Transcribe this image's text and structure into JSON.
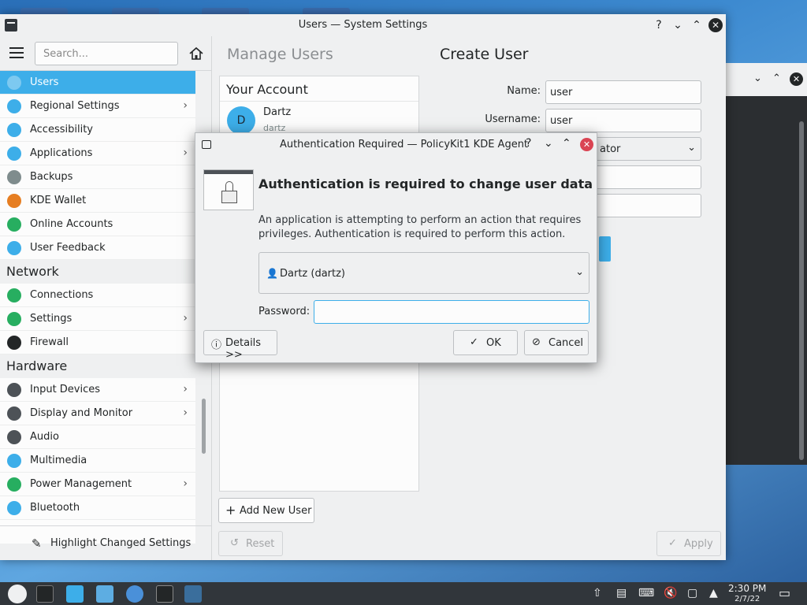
{
  "window": {
    "title": "Users — System Settings",
    "buttons": {
      "help": "?",
      "minimize": "⌄",
      "maximize": "⌃",
      "close": "✕"
    }
  },
  "sidebar": {
    "search_placeholder": "Search...",
    "items": [
      {
        "label": "Users",
        "icon": "users-icon",
        "selected": true,
        "chevron": false,
        "color": "#3daee9"
      },
      {
        "label": "Regional Settings",
        "icon": "flag-icon",
        "chevron": true,
        "color": "#3daee9"
      },
      {
        "label": "Accessibility",
        "icon": "accessibility-icon",
        "chevron": false,
        "color": "#3daee9"
      },
      {
        "label": "Applications",
        "icon": "applications-icon",
        "chevron": true,
        "color": "#3daee9"
      },
      {
        "label": "Backups",
        "icon": "backup-icon",
        "chevron": false,
        "color": "#7f8c8d"
      },
      {
        "label": "KDE Wallet",
        "icon": "wallet-icon",
        "chevron": false,
        "color": "#e67e22"
      },
      {
        "label": "Online Accounts",
        "icon": "globe-icon",
        "chevron": false,
        "color": "#27ae60"
      },
      {
        "label": "User Feedback",
        "icon": "feedback-icon",
        "chevron": false,
        "color": "#3daee9"
      }
    ],
    "network_header": "Network",
    "network_items": [
      {
        "label": "Connections",
        "icon": "network-globe-icon",
        "chevron": false,
        "color": "#27ae60"
      },
      {
        "label": "Settings",
        "icon": "network-settings-icon",
        "chevron": true,
        "color": "#27ae60"
      },
      {
        "label": "Firewall",
        "icon": "shield-icon",
        "chevron": false,
        "color": "#232627"
      }
    ],
    "hardware_header": "Hardware",
    "hardware_items": [
      {
        "label": "Input Devices",
        "icon": "keyboard-icon",
        "chevron": true,
        "color": "#4d5257"
      },
      {
        "label": "Display and Monitor",
        "icon": "monitor-icon",
        "chevron": true,
        "color": "#4d5257"
      },
      {
        "label": "Audio",
        "icon": "speaker-icon",
        "chevron": false,
        "color": "#4d5257"
      },
      {
        "label": "Multimedia",
        "icon": "multimedia-icon",
        "chevron": false,
        "color": "#3daee9"
      },
      {
        "label": "Power Management",
        "icon": "power-icon",
        "chevron": true,
        "color": "#27ae60"
      },
      {
        "label": "Bluetooth",
        "icon": "bluetooth-icon",
        "chevron": false,
        "color": "#3daee9"
      }
    ],
    "highlight_label": "Highlight Changed Settings"
  },
  "main": {
    "crumb_manage": "Manage Users",
    "crumb_create": "Create User",
    "account_header": "Your Account",
    "account_name": "Dartz",
    "account_username": "dartz",
    "avatar_letter": "D",
    "add_user_label": "Add New User",
    "reset_label": "Reset",
    "apply_label": "Apply",
    "form": {
      "name_label": "Name:",
      "name_value": "user",
      "username_label": "Username:",
      "username_value": "user",
      "type_value_partial": "ator"
    }
  },
  "dialog": {
    "title": "Authentication Required — PolicyKit1 KDE Agent",
    "heading": "Authentication is required to change user data",
    "message": "An application is attempting to perform an action that requires privileges. Authentication is required to perform this action.",
    "user_selected": "Dartz (dartz)",
    "password_label": "Password:",
    "password_value": "",
    "details_label": "Details >>",
    "ok_label": "OK",
    "cancel_label": "Cancel"
  },
  "taskbar": {
    "time": "2:30 PM",
    "date": "2/7/22"
  },
  "colors": {
    "accent": "#3daee9",
    "close_red": "#da4453",
    "taskbar": "#31363b"
  }
}
